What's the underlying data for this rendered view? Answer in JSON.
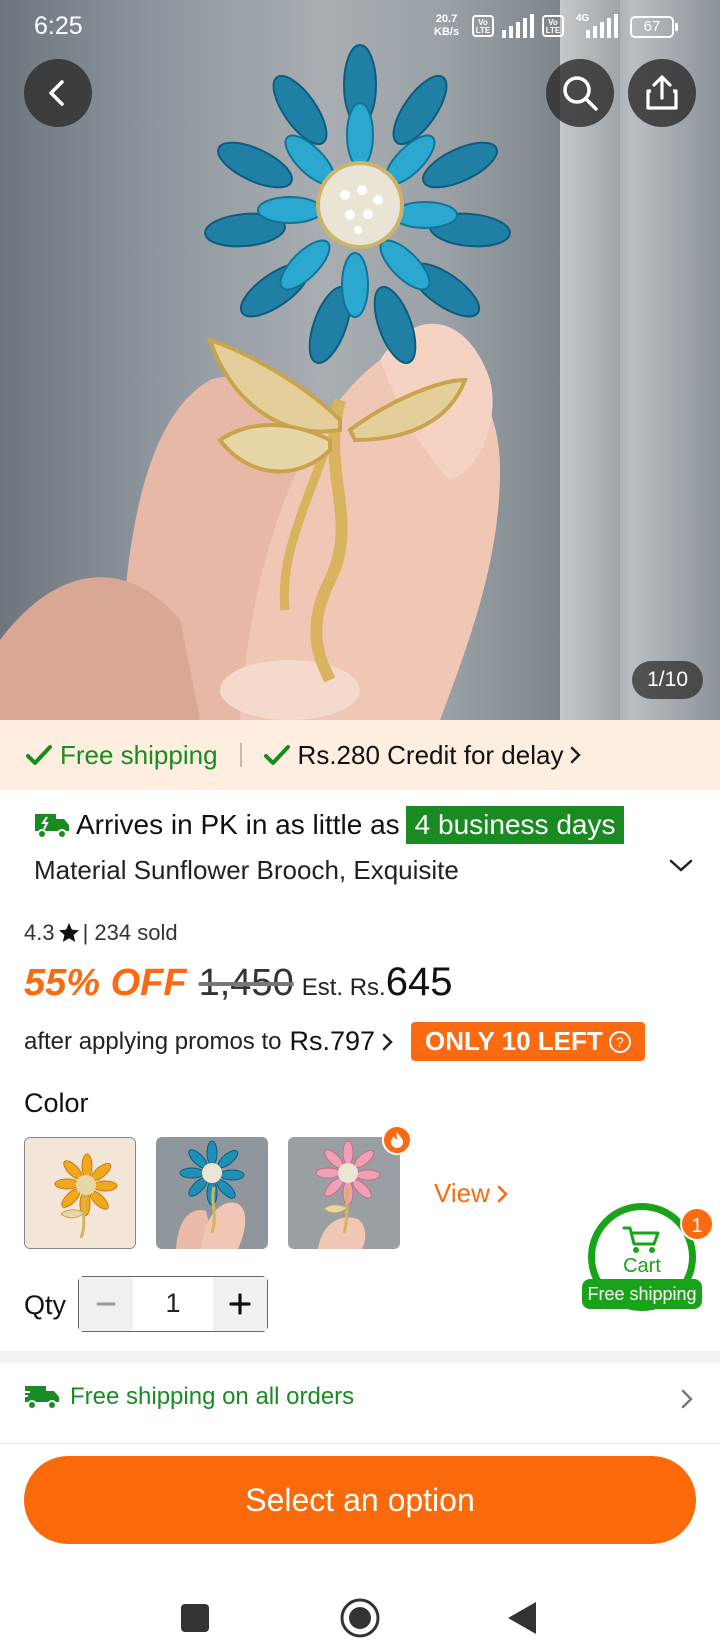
{
  "status_bar": {
    "time": "6:25",
    "net_speed_value": "20.7",
    "net_speed_unit": "KB/s",
    "lte1": "Vo LTE",
    "lte2": "Vo LTE",
    "network_type": "4G",
    "battery": "67"
  },
  "gallery": {
    "counter": "1/10",
    "product_image": "crystal-sunflower-brooch"
  },
  "shipping_strip": {
    "free_shipping": "Free shipping",
    "credit": "Rs.280 Credit for delay"
  },
  "delivery": {
    "text": "Arrives in PK in as little as",
    "badge": "4 business days"
  },
  "product": {
    "title": "Material Sunflower Brooch, Exquisite",
    "rating": "4.3",
    "sold": "| 234 sold",
    "discount": "55% OFF",
    "original_price": "1,450",
    "est_label": "Est. Rs.",
    "est_price": "645",
    "promo_text": "after applying promos to",
    "promo_price": "Rs.797",
    "stock_badge": "ONLY 10 LEFT"
  },
  "options": {
    "color_label": "Color",
    "swatches": [
      "gold-yellow-sunflower",
      "blue-sunflower",
      "pink-sunflower"
    ],
    "view_label": "View",
    "qty_label": "Qty",
    "qty_value": "1"
  },
  "cart": {
    "label": "Cart",
    "badge_count": "1",
    "ship_label": "Free shipping"
  },
  "free_shipping_all": "Free shipping on all orders",
  "cta": "Select an option",
  "colors": {
    "accent_orange": "#fa6a0a",
    "green": "#1a8a22",
    "strip_bg": "#fdeee0"
  }
}
